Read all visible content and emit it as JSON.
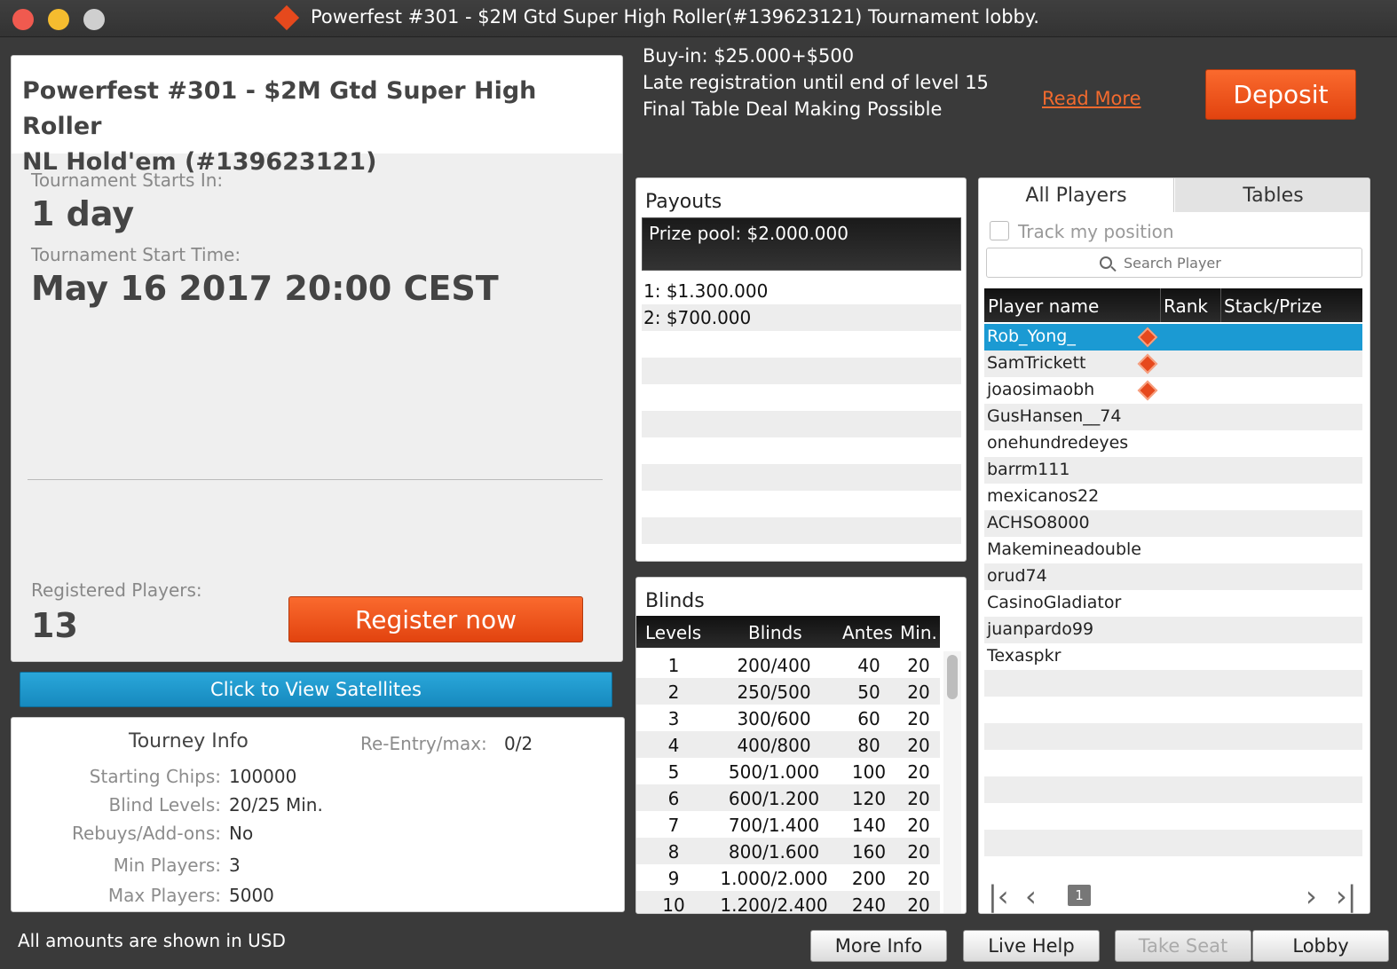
{
  "window": {
    "title": "Powerfest #301 - $2M Gtd Super High Roller(#139623121) Tournament lobby."
  },
  "header": {
    "info_lines": [
      "Buy-in: $25.000+$500",
      "Late registration until end of level 15",
      "Final Table Deal Making Possible"
    ],
    "read_more": "Read More",
    "deposit": "Deposit"
  },
  "tournament": {
    "name_line1": "Powerfest #301 - $2M Gtd Super High Roller",
    "name_line2": "NL Hold'em (#139623121)",
    "starts_in_label": "Tournament Starts In:",
    "starts_in_value": "1 day",
    "start_time_label": "Tournament Start Time:",
    "start_time_value": "May 16 2017 20:00 CEST",
    "registered_label": "Registered Players:",
    "registered_value": "13",
    "register_button": "Register now",
    "satellites_button": "Click to View Satellites"
  },
  "tourney_info": {
    "title": "Tourney Info",
    "reentry_label": "Re-Entry/max:",
    "reentry_value": "0/2",
    "rows": [
      {
        "label": "Starting Chips:",
        "value": "100000"
      },
      {
        "label": "Blind Levels:",
        "value": "20/25 Min."
      },
      {
        "label": "Rebuys/Add-ons:",
        "value": "No"
      },
      {
        "label": "Min Players:",
        "value": "3"
      },
      {
        "label": "Max Players:",
        "value": "5000"
      }
    ]
  },
  "payouts": {
    "title": "Payouts",
    "prize_pool": "Prize pool: $2.000.000",
    "rows": [
      "1: $1.300.000",
      "2: $700.000",
      "",
      "",
      "",
      "",
      "",
      "",
      "",
      "",
      ""
    ]
  },
  "blinds": {
    "title": "Blinds",
    "headers": {
      "levels": "Levels",
      "blinds": "Blinds",
      "antes": "Antes",
      "min": "Min."
    },
    "rows": [
      {
        "level": "1",
        "blinds": "200/400",
        "antes": "40",
        "min": "20"
      },
      {
        "level": "2",
        "blinds": "250/500",
        "antes": "50",
        "min": "20"
      },
      {
        "level": "3",
        "blinds": "300/600",
        "antes": "60",
        "min": "20"
      },
      {
        "level": "4",
        "blinds": "400/800",
        "antes": "80",
        "min": "20"
      },
      {
        "level": "5",
        "blinds": "500/1.000",
        "antes": "100",
        "min": "20"
      },
      {
        "level": "6",
        "blinds": "600/1.200",
        "antes": "120",
        "min": "20"
      },
      {
        "level": "7",
        "blinds": "700/1.400",
        "antes": "140",
        "min": "20"
      },
      {
        "level": "8",
        "blinds": "800/1.600",
        "antes": "160",
        "min": "20"
      },
      {
        "level": "9",
        "blinds": "1.000/2.000",
        "antes": "200",
        "min": "20"
      },
      {
        "level": "10",
        "blinds": "1.200/2.400",
        "antes": "240",
        "min": "20"
      }
    ]
  },
  "players": {
    "tab_all": "All Players",
    "tab_tables": "Tables",
    "track_label": "Track my position",
    "search_placeholder": "Search Player",
    "headers": {
      "name": "Player name",
      "rank": "Rank",
      "stack": "Stack/Prize"
    },
    "rows": [
      {
        "name": "Rob_Yong_",
        "pro": true,
        "selected": true
      },
      {
        "name": "SamTrickett",
        "pro": true
      },
      {
        "name": "joaosimaobh",
        "pro": true
      },
      {
        "name": "GusHansen__74"
      },
      {
        "name": "onehundredeyes"
      },
      {
        "name": "barrm111"
      },
      {
        "name": "mexicanos22"
      },
      {
        "name": "ACHSO8000"
      },
      {
        "name": "Makemineadouble"
      },
      {
        "name": "orud74"
      },
      {
        "name": "CasinoGladiator"
      },
      {
        "name": "juanpardo99"
      },
      {
        "name": "Texaspkr"
      },
      {
        "name": ""
      },
      {
        "name": ""
      },
      {
        "name": ""
      },
      {
        "name": ""
      },
      {
        "name": ""
      },
      {
        "name": ""
      },
      {
        "name": ""
      }
    ],
    "page": "1"
  },
  "footer": {
    "note": "All amounts are shown in USD",
    "more_info": "More Info",
    "live_help": "Live Help",
    "take_seat": "Take Seat",
    "lobby": "Lobby"
  },
  "colors": {
    "accent_orange": "#e6491d",
    "selection_blue": "#1b9ad3"
  }
}
